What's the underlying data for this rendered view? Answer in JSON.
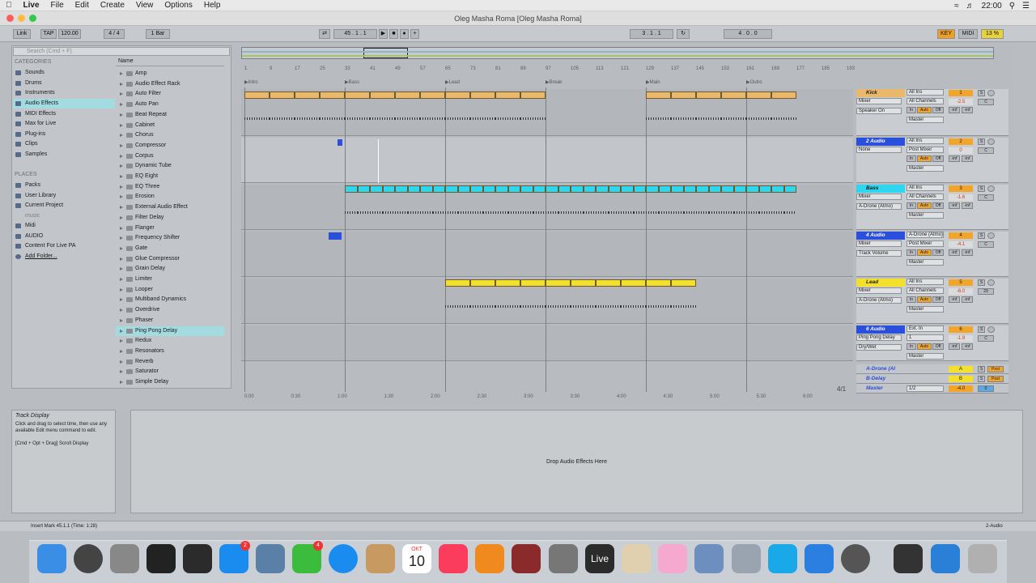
{
  "menubar": {
    "apple": "",
    "app": "Live",
    "items": [
      "File",
      "Edit",
      "Create",
      "View",
      "Options",
      "Help"
    ],
    "clock": "22:00"
  },
  "window": {
    "title": "Oleg Masha Roma  [Oleg Masha Roma]"
  },
  "control_bar": {
    "link": "Link",
    "tap": "TAP",
    "tempo": "120.00",
    "signature": "4 / 4",
    "quantize": "1 Bar",
    "position": "45 . 1 . 1",
    "loop_start": "3 . 1 . 1",
    "loop_length": "4 . 0 . 0",
    "key": "KEY",
    "midi": "MIDI",
    "cpu": "13 %"
  },
  "browser": {
    "search_placeholder": "Search (Cmd + F)",
    "categories_label": "CATEGORIES",
    "categories": [
      "Sounds",
      "Drums",
      "Instruments",
      "Audio Effects",
      "MIDI Effects",
      "Max for Live",
      "Plug-ins",
      "Clips",
      "Samples"
    ],
    "places_label": "PLACES",
    "places": [
      "Packs",
      "User Library",
      "Current Project",
      "music",
      "Midi",
      "AUDIO",
      "Content For Live PA",
      "Add Folder..."
    ],
    "name_header": "Name",
    "devices": [
      "Amp",
      "Audio Effect Rack",
      "Auto Filter",
      "Auto Pan",
      "Beat Repeat",
      "Cabinet",
      "Chorus",
      "Compressor",
      "Corpus",
      "Dynamic Tube",
      "EQ Eight",
      "EQ Three",
      "Erosion",
      "External Audio Effect",
      "Filter Delay",
      "Flanger",
      "Frequency Shifter",
      "Gate",
      "Glue Compressor",
      "Grain Delay",
      "Limiter",
      "Looper",
      "Multiband Dynamics",
      "Overdrive",
      "Phaser",
      "Ping Pong Delay",
      "Redux",
      "Resonators",
      "Reverb",
      "Saturator",
      "Simple Delay"
    ]
  },
  "arrangement": {
    "bars": [
      "1",
      "9",
      "17",
      "25",
      "33",
      "41",
      "49",
      "57",
      "65",
      "73",
      "81",
      "89",
      "97",
      "105",
      "113",
      "121",
      "129",
      "137",
      "145",
      "153",
      "161",
      "169",
      "177",
      "185",
      "193"
    ],
    "locators": [
      "Intro",
      "Bass",
      "Lead",
      "Break",
      "Main",
      "Outro"
    ],
    "times": [
      "0:00",
      "0:30",
      "1:00",
      "1:30",
      "2:00",
      "2:30",
      "3:00",
      "3:30",
      "4:00",
      "4:30",
      "5:00",
      "5:30",
      "6:00"
    ],
    "fraction": "4/1"
  },
  "tracks": [
    {
      "name": "Kick",
      "input": "All Ins",
      "monitor": "Mixer",
      "channel": "All Channels",
      "device": "Speaker On",
      "num": "1",
      "vol": "-2.5",
      "pan": "C",
      "out": "Master"
    },
    {
      "name": "2 Audio",
      "input": "All Ins",
      "monitor": "None",
      "channel": "Post Mixer",
      "device": "",
      "num": "2",
      "vol": "0",
      "pan": "C",
      "out": "Master"
    },
    {
      "name": "Bass",
      "input": "All Ins",
      "monitor": "Mixer",
      "channel": "All Channels",
      "device": "A-Drone (Atmo)",
      "num": "3",
      "vol": "-1.6",
      "pan": "C",
      "out": "Master"
    },
    {
      "name": "4 Audio",
      "input": "A-Drone (Atmo)",
      "monitor": "Mixer",
      "channel": "Post Mixer",
      "device": "Track Volume",
      "num": "4",
      "vol": "-4.1",
      "pan": "C",
      "out": "Master"
    },
    {
      "name": "Lead",
      "input": "All Ins",
      "monitor": "Mixer",
      "channel": "All Channels",
      "device": "A-Drone (Atmo)",
      "num": "5",
      "vol": "-6.0",
      "pan": "29",
      "out": "Master"
    },
    {
      "name": "6 Audio",
      "input": "Ext. In",
      "monitor": "Ping Pong Delay",
      "channel": "1",
      "device": "Dry/Wet",
      "num": "6",
      "vol": "-1.9",
      "pan": "C",
      "out": "Master"
    }
  ],
  "returns": [
    {
      "name": "A-Drone (Al",
      "letter": "A",
      "btn": "Post"
    },
    {
      "name": "B-Delay",
      "letter": "B",
      "btn": "Post"
    },
    {
      "name": "Master",
      "out": "1/2",
      "vol": "-4.0",
      "pan": "0"
    }
  ],
  "mixer_common": {
    "in": "In",
    "auto": "Auto",
    "off": "Off",
    "inf": "-inf",
    "s": "S"
  },
  "info_view": {
    "title": "Track Display",
    "body": "Click and drag to select time, then use any available Edit menu command to edit.",
    "hint": "[Cmd + Opt + Drag] Scroll Display"
  },
  "device_view": {
    "drop_text": "Drop Audio Effects Here"
  },
  "status": {
    "left": "Insert Mark 45.1.1 (Time: 1:28)",
    "right": "2-Audio"
  },
  "dock": {
    "badge_appstore": "2",
    "badge_messages": "4",
    "calendar_month": "ОКТ",
    "calendar_day": "10",
    "live_label": "Live"
  },
  "colors": {
    "kick_clip": "#e9b86a",
    "bass_clip": "#2ed6f0",
    "lead_clip": "#f2e02c",
    "selected": "#a3dce0",
    "track_blue": "#2a4fdc"
  }
}
